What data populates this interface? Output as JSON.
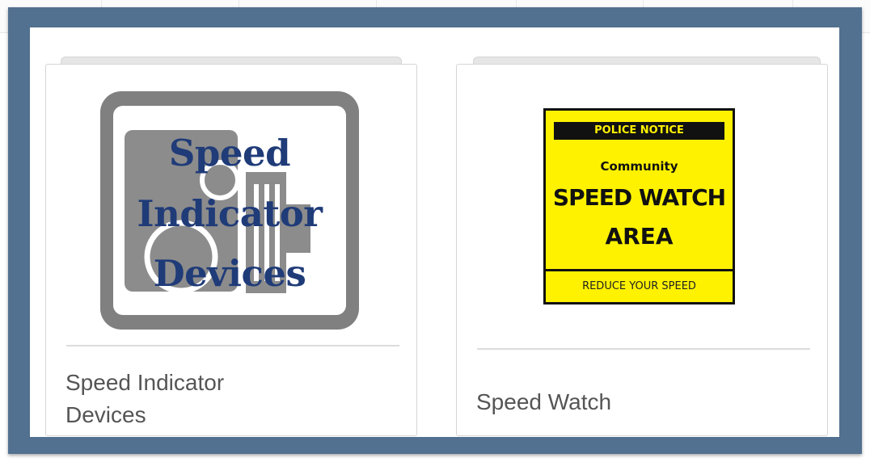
{
  "cards": [
    {
      "label_line1": "Speed Indicator",
      "label_line2": "Devices",
      "image": {
        "icon": "speed-indicator-devices-logo",
        "text_lines": [
          "Speed",
          "Indicator",
          "Devices"
        ],
        "text_color": "#1f3b78",
        "frame_color": "#808080"
      }
    },
    {
      "label": "Speed Watch",
      "image": {
        "icon": "speed-watch-sign",
        "top_text": "POLICE NOTICE",
        "line1": "Community",
        "line2": "SPEED WATCH",
        "line3": "AREA",
        "bottom_text": "REDUCE YOUR SPEED",
        "sign_color": "#fff200"
      }
    }
  ],
  "colors": {
    "frame": "#52708f",
    "card_border": "#d5d5d5",
    "label_text": "#555555"
  }
}
